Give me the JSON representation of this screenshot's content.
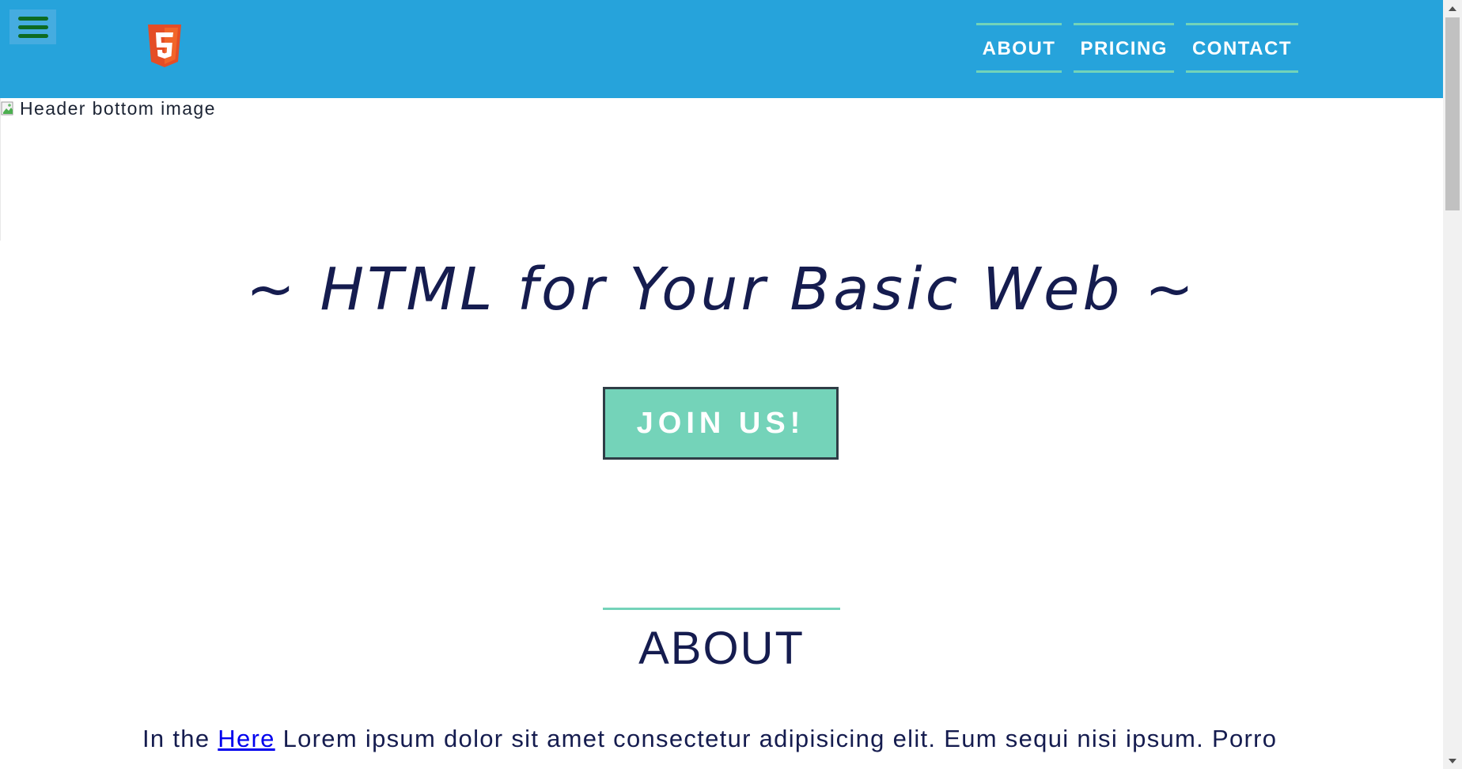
{
  "header": {
    "background": "#26a3db",
    "menu_icon": "hamburger-menu-icon",
    "logo_icon": "html5-logo-icon",
    "nav": [
      {
        "label": "ABOUT"
      },
      {
        "label": "PRICING"
      },
      {
        "label": "CONTACT"
      }
    ]
  },
  "header_bottom_image": {
    "alt": "Header bottom image",
    "icon": "broken-image-icon"
  },
  "hero": {
    "title": "~ HTML for Your Basic Web ~",
    "cta_label": "JOIN US!"
  },
  "about": {
    "heading": "ABOUT",
    "text_before_link": "In the ",
    "link_text": "Here",
    "text_after_link": " Lorem ipsum dolor sit amet consectetur adipisicing elit. Eum sequi nisi ipsum. Porro"
  },
  "colors": {
    "accent": "#74d3b9",
    "text_dark": "#151c4f",
    "header_blue": "#26a3db"
  },
  "scrollbar": {
    "up_icon": "scroll-up-arrow-icon",
    "down_icon": "scroll-down-arrow-icon"
  }
}
